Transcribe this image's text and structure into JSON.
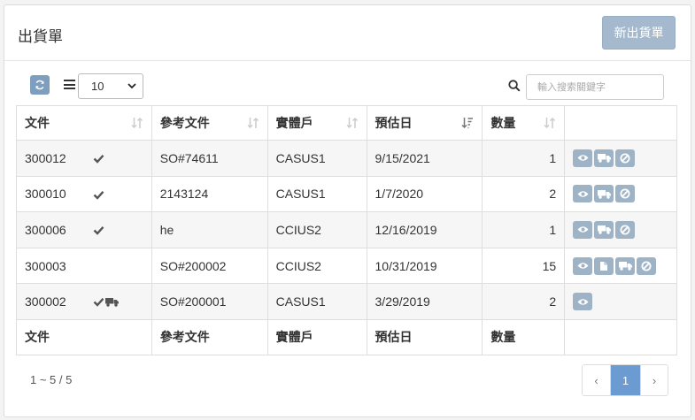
{
  "header": {
    "title": "出貨單",
    "new_button": "新出貨單"
  },
  "toolbar": {
    "page_size": "10",
    "search_placeholder": "輸入搜索關鍵字"
  },
  "table": {
    "columns": [
      "文件",
      "參考文件",
      "實體戶",
      "預估日",
      "數量",
      ""
    ],
    "footer_columns": [
      "文件",
      "參考文件",
      "實體戶",
      "預估日",
      "數量",
      ""
    ],
    "rows": [
      {
        "doc": "300012",
        "ref": "SO#74611",
        "entity": "CASUS1",
        "date": "9/15/2021",
        "qty": "1",
        "flags": [
          "check-icon"
        ],
        "actions": [
          "eye-icon",
          "truck-icon",
          "ban-icon"
        ]
      },
      {
        "doc": "300010",
        "ref": "2143124",
        "entity": "CASUS1",
        "date": "1/7/2020",
        "qty": "2",
        "flags": [
          "check-icon"
        ],
        "actions": [
          "eye-icon",
          "truck-icon",
          "ban-icon"
        ]
      },
      {
        "doc": "300006",
        "ref": "he",
        "entity": "CCIUS2",
        "date": "12/16/2019",
        "qty": "1",
        "flags": [
          "check-icon"
        ],
        "actions": [
          "eye-icon",
          "truck-icon",
          "ban-icon"
        ]
      },
      {
        "doc": "300003",
        "ref": "SO#200002",
        "entity": "CCIUS2",
        "date": "10/31/2019",
        "qty": "15",
        "flags": [],
        "actions": [
          "eye-icon",
          "copy-icon",
          "truck-icon",
          "ban-icon"
        ]
      },
      {
        "doc": "300002",
        "ref": "SO#200001",
        "entity": "CASUS1",
        "date": "3/29/2019",
        "qty": "2",
        "flags": [
          "check-icon",
          "truck-icon"
        ],
        "actions": [
          "eye-icon"
        ]
      }
    ]
  },
  "footer": {
    "summary": "1 ~ 5 / 5",
    "prev": "‹",
    "page": "1",
    "next": "›"
  },
  "colors": {
    "action_button": "#9fb3c7",
    "accent": "#6b9bd1",
    "new_button": "#a4b9cd"
  }
}
